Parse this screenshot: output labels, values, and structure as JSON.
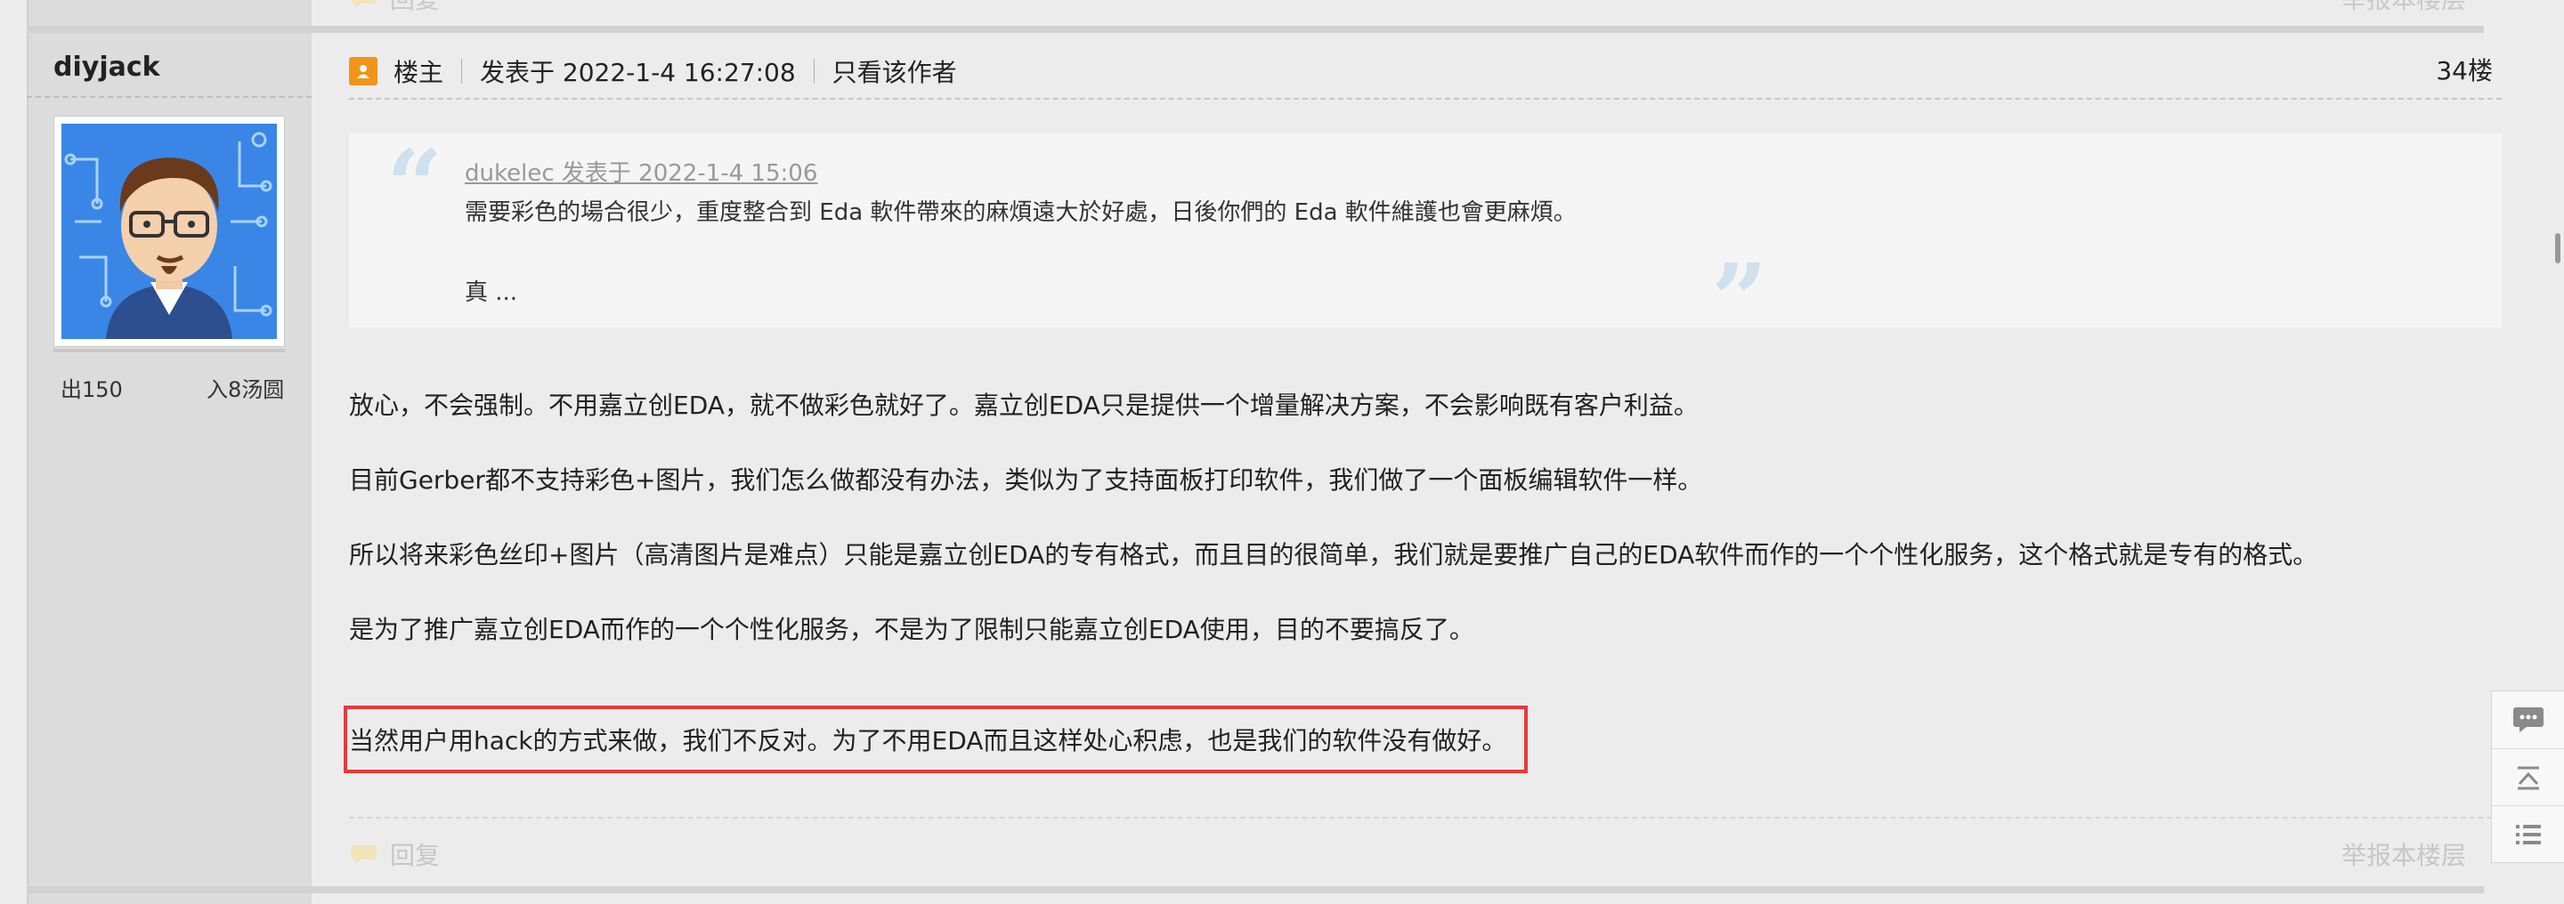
{
  "prev_post": {
    "reply_label": "回复",
    "report_label": "举报本楼层"
  },
  "author": {
    "name": "diyjack",
    "stat_out": "出150",
    "stat_in": "入8汤圆"
  },
  "post": {
    "role_label": "楼主",
    "posted_at": "发表于 2022-1-4 16:27:08",
    "only_author_link": "只看该作者",
    "floor": "34楼",
    "quote": {
      "author_line": "dukelec 发表于 2022-1-4 15:06",
      "line1": "需要彩色的場合很少，重度整合到 Eda 軟件帶來的麻煩遠大於好處，日後你們的 Eda 軟件維護也會更麻煩。",
      "line2": "真 ..."
    },
    "paragraphs": [
      "放心，不会强制。不用嘉立创EDA，就不做彩色就好了。嘉立创EDA只是提供一个增量解决方案，不会影响既有客户利益。",
      "目前Gerber都不支持彩色+图片，我们怎么做都没有办法，类似为了支持面板打印软件，我们做了一个面板编辑软件一样。",
      "所以将来彩色丝印+图片（高清图片是难点）只能是嘉立创EDA的专有格式，而且目的很简单，我们就是要推广自己的EDA软件而作的一个个性化服务，这个格式就是专有的格式。",
      "是为了推广嘉立创EDA而作的一个个性化服务，不是为了限制只能嘉立创EDA使用，目的不要搞反了。"
    ],
    "highlighted": "当然用户用hack的方式来做，我们不反对。为了不用EDA而且这样处心积虑，也是我们的软件没有做好。",
    "reply_label": "回复",
    "report_label": "举报本楼层"
  },
  "float_tools": [
    "comment-icon",
    "back-to-top-icon",
    "list-icon"
  ],
  "colors": {
    "highlight_border": "#e43a3a",
    "owner_badge": "#f0951a",
    "avatar_bg": "#3a86e6"
  }
}
